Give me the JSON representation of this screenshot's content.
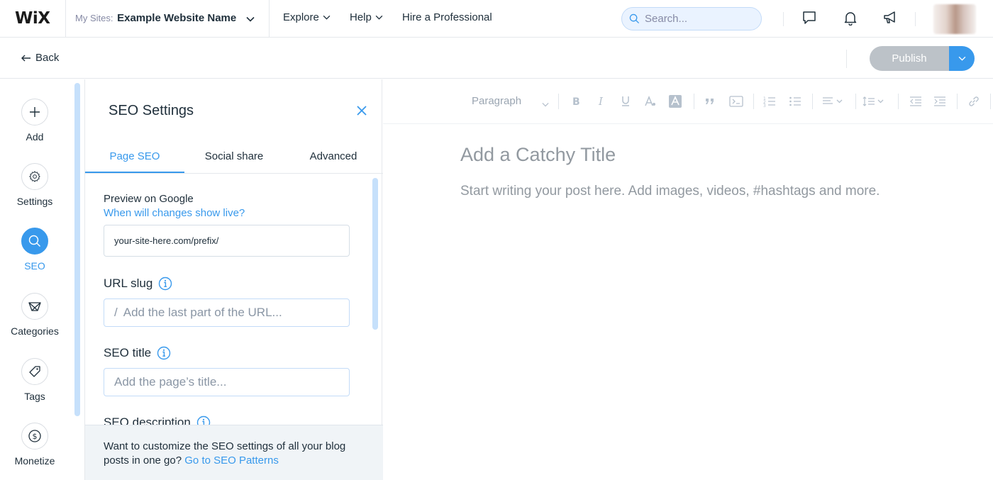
{
  "topbar": {
    "logo": "WiX",
    "my_sites_label": "My Sites:",
    "site_name": "Example Website Name",
    "nav": [
      "Explore",
      "Help",
      "Hire a Professional"
    ],
    "search_placeholder": "Search...",
    "icons": [
      "chat-bubble-icon",
      "bell-icon",
      "megaphone-icon"
    ]
  },
  "subbar": {
    "back_label": "Back",
    "publish_label": "Publish"
  },
  "rail": {
    "items": [
      {
        "label": "Add",
        "icon": "plus-icon"
      },
      {
        "label": "Settings",
        "icon": "gear-icon"
      },
      {
        "label": "SEO",
        "icon": "search-icon",
        "active": true
      },
      {
        "label": "Categories",
        "icon": "categories-icon"
      },
      {
        "label": "Tags",
        "icon": "tag-icon"
      },
      {
        "label": "Monetize",
        "icon": "dollar-coin-icon"
      }
    ]
  },
  "panel": {
    "title": "SEO Settings",
    "tabs": [
      "Page SEO",
      "Social share",
      "Advanced"
    ],
    "preview_label": "Preview on Google",
    "preview_link": "When will changes show live?",
    "preview_url": "your-site-here.com/prefix/",
    "url_slug_label": "URL slug",
    "url_slug_prefix": "/",
    "url_slug_placeholder": "Add the last part of the URL...",
    "seo_title_label": "SEO title",
    "seo_title_placeholder": "Add the page’s title...",
    "seo_description_label": "SEO description",
    "footer_text": "Want to customize the SEO settings of all your blog posts in one go?",
    "footer_link": "Go to SEO Patterns"
  },
  "editor": {
    "paragraph_label": "Paragraph",
    "title_placeholder": "Add a Catchy Title",
    "body_placeholder": "Start writing your post here. Add images, videos, #hashtags and more."
  },
  "colors": {
    "accent": "#3899ec",
    "publish_disabled": "#bcc2c8",
    "text": "#20303c"
  }
}
